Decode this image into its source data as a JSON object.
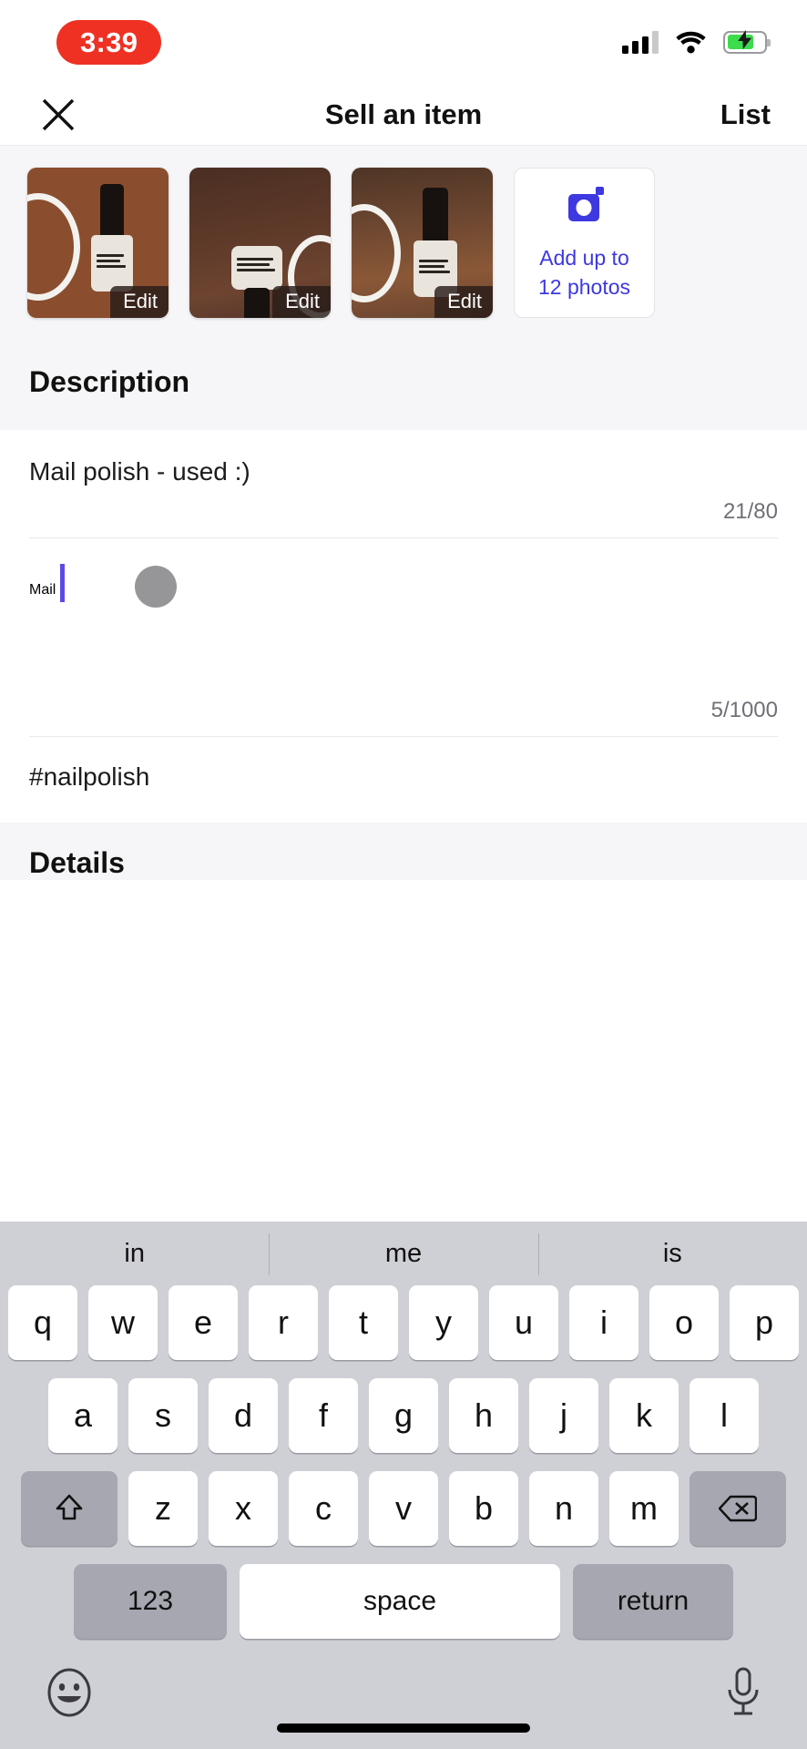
{
  "status_bar": {
    "time": "3:39",
    "time_pill_color": "#ef3124",
    "signal_icon": "cellular-bars-icon",
    "wifi_icon": "wifi-icon",
    "battery_icon": "battery-charging-icon",
    "battery_color": "#3ddc4d"
  },
  "nav": {
    "close_label": "✕",
    "title": "Sell an item",
    "action_label": "List"
  },
  "photos": {
    "items": [
      {
        "edit_label": "Edit",
        "alt": "clear nail polish bottle on wooden table with white cable"
      },
      {
        "edit_label": "Edit",
        "alt": "nail polish bottle lying on wooden table"
      },
      {
        "edit_label": "Edit",
        "alt": "nail polish bottle upright with cable loop"
      }
    ],
    "add_tile": {
      "icon": "camera-icon",
      "line1": "Add up to",
      "line2": "12 photos",
      "accent_color": "#3d38e0"
    }
  },
  "description": {
    "header": "Description",
    "title_field": {
      "value": "Mail polish - used :)",
      "counter": "21/80"
    },
    "body_field": {
      "value": "Mail",
      "counter": "5/1000",
      "caret_color": "#5b4be6",
      "touch_indicator": "touch-point-indicator"
    },
    "tags_field": {
      "value": "#nailpolish"
    }
  },
  "details": {
    "header": "Details"
  },
  "keyboard": {
    "suggestions": [
      "in",
      "me",
      "is"
    ],
    "row1": [
      "q",
      "w",
      "e",
      "r",
      "t",
      "y",
      "u",
      "i",
      "o",
      "p"
    ],
    "row2": [
      "a",
      "s",
      "d",
      "f",
      "g",
      "h",
      "j",
      "k",
      "l"
    ],
    "row3": [
      "z",
      "x",
      "c",
      "v",
      "b",
      "n",
      "m"
    ],
    "shift_key": "shift-icon",
    "backspace_key": "backspace-icon",
    "numbers_key": "123",
    "space_key": "space",
    "return_key": "return",
    "emoji_key": "emoji-icon",
    "dictation_key": "microphone-icon"
  }
}
